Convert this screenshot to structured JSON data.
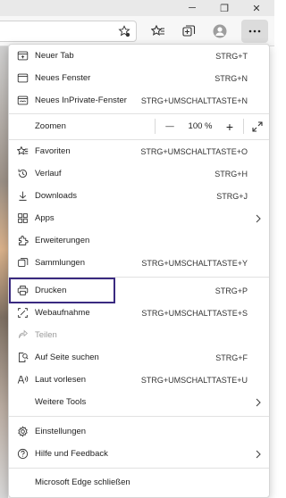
{
  "window": {
    "buttons": [
      "─",
      "❐",
      "✕"
    ]
  },
  "menu": {
    "items": [
      {
        "key": "new_tab",
        "label": "Neuer Tab",
        "shortcut": "STRG+T",
        "icon": "new-tab-icon"
      },
      {
        "key": "new_window",
        "label": "Neues Fenster",
        "shortcut": "STRG+N",
        "icon": "new-window-icon"
      },
      {
        "key": "new_private",
        "label": "Neues InPrivate-Fenster",
        "shortcut": "STRG+UMSCHALTTASTE+N",
        "icon": "inprivate-window-icon"
      }
    ],
    "zoom": {
      "label": "Zoomen",
      "minus": "—",
      "value": "100 %",
      "plus": "+"
    },
    "items2": [
      {
        "key": "favorites",
        "label": "Favoriten",
        "shortcut": "STRG+UMSCHALTTASTE+O",
        "icon": "favorites-icon"
      },
      {
        "key": "history",
        "label": "Verlauf",
        "shortcut": "STRG+H",
        "icon": "history-icon"
      },
      {
        "key": "downloads",
        "label": "Downloads",
        "shortcut": "STRG+J",
        "icon": "download-icon"
      },
      {
        "key": "apps",
        "label": "Apps",
        "shortcut": "",
        "icon": "apps-icon"
      },
      {
        "key": "extensions",
        "label": "Erweiterungen",
        "shortcut": "",
        "icon": "extensions-icon"
      },
      {
        "key": "collections",
        "label": "Sammlungen",
        "shortcut": "STRG+UMSCHALTTASTE+Y",
        "icon": "collections-icon"
      }
    ],
    "items3": [
      {
        "key": "print",
        "label": "Drucken",
        "shortcut": "STRG+P",
        "icon": "print-icon"
      },
      {
        "key": "capture",
        "label": "Webaufnahme",
        "shortcut": "STRG+UMSCHALTTASTE+S",
        "icon": "web-capture-icon"
      },
      {
        "key": "share",
        "label": "Teilen",
        "shortcut": "",
        "icon": "share-icon"
      },
      {
        "key": "find",
        "label": "Auf Seite suchen",
        "shortcut": "STRG+F",
        "icon": "find-on-page-icon"
      },
      {
        "key": "read",
        "label": "Laut vorlesen",
        "shortcut": "STRG+UMSCHALTTASTE+U",
        "icon": "read-aloud-icon"
      },
      {
        "key": "more_tools",
        "label": "Weitere Tools",
        "shortcut": "",
        "icon": "more-tools"
      }
    ],
    "items4": [
      {
        "key": "settings",
        "label": "Einstellungen",
        "shortcut": "",
        "icon": "settings-icon"
      },
      {
        "key": "help",
        "label": "Hilfe und Feedback",
        "shortcut": "",
        "icon": "help-icon"
      }
    ],
    "close_label": "Microsoft Edge schließen",
    "highlight_color": "#3a2a80"
  }
}
